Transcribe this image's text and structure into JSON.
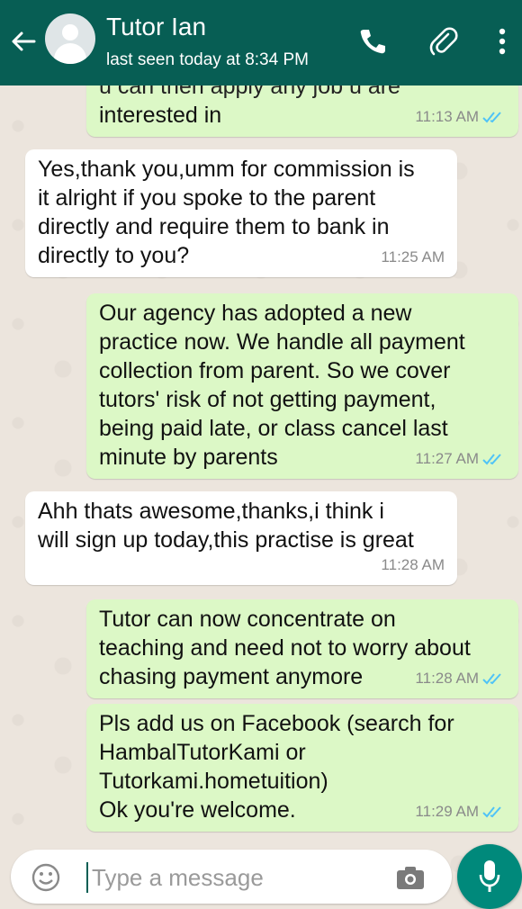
{
  "header": {
    "contact_name": "Tutor Ian",
    "status": "last seen today at 8:34 PM"
  },
  "messages": [
    {
      "direction": "out",
      "partial_top": "u can then apply any job u are",
      "text": "interested in",
      "time": "11:13 AM",
      "ticks": "read"
    },
    {
      "direction": "in",
      "text": "Yes,thank you,umm for commission is\nit alright if you spoke to the parent\ndirectly and require them to bank in\ndirectly to you?",
      "time": "11:25 AM"
    },
    {
      "direction": "out",
      "text": "Our agency has adopted a new\npractice now. We handle all payment\ncollection from parent. So we cover\ntutors' risk of not getting payment,\nbeing paid late, or class cancel last\nminute by parents",
      "time": "11:27 AM",
      "ticks": "read"
    },
    {
      "direction": "in",
      "text": "Ahh thats awesome,thanks,i think i\nwill sign up today,this practise is great",
      "time": "11:28 AM"
    },
    {
      "direction": "out",
      "text": "Tutor can now concentrate on\nteaching and need not to worry about\nchasing payment anymore",
      "time": "11:28 AM",
      "ticks": "read"
    },
    {
      "direction": "out",
      "text": "Pls add us on Facebook (search for\nHambalTutorKami or\nTutorkami.hometuition)\nOk you're welcome.",
      "time": "11:29 AM",
      "ticks": "read"
    }
  ],
  "composer": {
    "placeholder": "Type a message"
  },
  "icons": {
    "back": "arrow-left-icon",
    "call": "phone-icon",
    "attach": "paperclip-icon",
    "menu": "more-vertical-icon",
    "emoji": "emoji-icon",
    "camera": "camera-icon",
    "mic": "microphone-icon"
  },
  "colors": {
    "header": "#075e54",
    "outgoing_bubble": "#dcf8c6",
    "incoming_bubble": "#ffffff",
    "read_ticks": "#4fc3f7",
    "mic_button": "#00897b"
  }
}
